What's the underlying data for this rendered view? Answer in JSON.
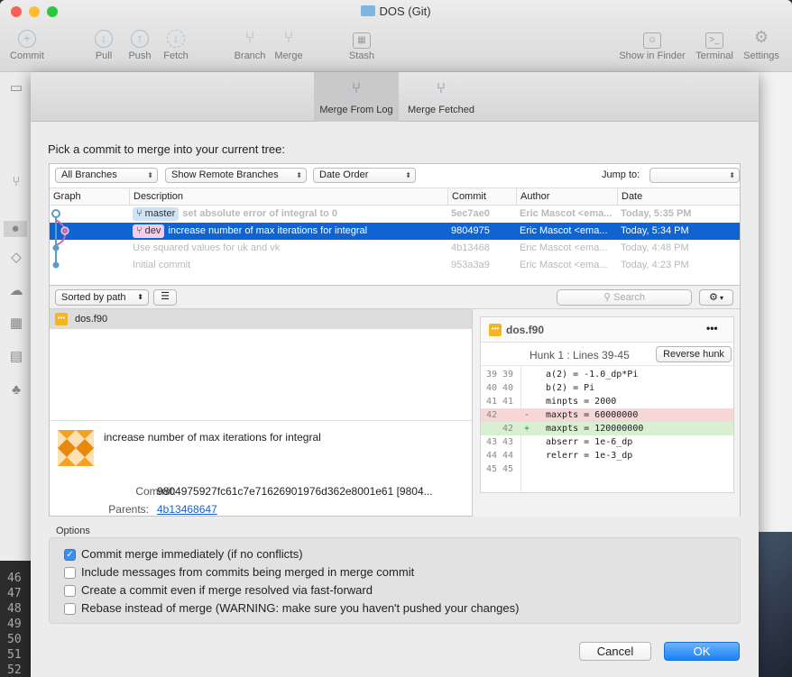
{
  "window": {
    "title": "DOS (Git)"
  },
  "toolbar": {
    "commit": "Commit",
    "pull": "Pull",
    "push": "Push",
    "fetch": "Fetch",
    "branch": "Branch",
    "merge": "Merge",
    "stash": "Stash",
    "show_in_finder": "Show in Finder",
    "terminal": "Terminal",
    "settings": "Settings"
  },
  "tabs": [
    {
      "label": "Merge From Log",
      "icon": "merge-icon",
      "selected": true
    },
    {
      "label": "Merge Fetched",
      "icon": "merge-icon",
      "selected": false
    }
  ],
  "prompt": "Pick a commit to merge into your current tree:",
  "filters": {
    "branches": "All Branches",
    "remote": "Show Remote Branches",
    "order": "Date Order",
    "jump_label": "Jump to:",
    "jump_value": ""
  },
  "columns": {
    "graph": "Graph",
    "description": "Description",
    "commit": "Commit",
    "author": "Author",
    "date": "Date"
  },
  "commits": [
    {
      "branch": "master",
      "message": "set absolute error of integral to 0",
      "hash": "5ec7ae0",
      "author": "Eric Mascot <ema...",
      "date": "Today, 5:35 PM"
    },
    {
      "branch": "dev",
      "message": "increase number of max iterations for integral",
      "hash": "9804975",
      "author": "Eric Mascot <ema...",
      "date": "Today, 5:34 PM"
    },
    {
      "branch": "",
      "message": "Use squared values for uk and vk",
      "hash": "4b13468",
      "author": "Eric Mascot <ema...",
      "date": "Today, 4:48 PM"
    },
    {
      "branch": "",
      "message": "Initial commit",
      "hash": "953a3a9",
      "author": "Eric Mascot <ema...",
      "date": "Today, 4:23 PM"
    }
  ],
  "files_toolbar": {
    "sort": "Sorted by path",
    "search_placeholder": "Search"
  },
  "selected_file": "dos.f90",
  "commit_info": {
    "message": "increase number of max iterations for integral",
    "commit_label": "Commit:",
    "commit_value": "9804975927fc61c7e71626901976d362e8001e61 [9804...",
    "parents_label": "Parents:",
    "parents_value": "4b13468647"
  },
  "diff": {
    "file": "dos.f90",
    "more": "•••",
    "hunk": "Hunk 1 : Lines 39-45",
    "reverse": "Reverse hunk",
    "lines": [
      {
        "old": "39",
        "new": "39",
        "mark": "",
        "text": "a(2) = -1.0_dp*Pi",
        "type": "ctx"
      },
      {
        "old": "40",
        "new": "40",
        "mark": "",
        "text": "b(2) = Pi",
        "type": "ctx"
      },
      {
        "old": "41",
        "new": "41",
        "mark": "",
        "text": "minpts = 2000",
        "type": "ctx"
      },
      {
        "old": "42",
        "new": "",
        "mark": "-",
        "text": "maxpts = 60000000",
        "type": "del"
      },
      {
        "old": "",
        "new": "42",
        "mark": "+",
        "text": "maxpts = 120000000",
        "type": "add"
      },
      {
        "old": "43",
        "new": "43",
        "mark": "",
        "text": "abserr = 1e-6_dp",
        "type": "ctx"
      },
      {
        "old": "44",
        "new": "44",
        "mark": "",
        "text": "relerr = 1e-3_dp",
        "type": "ctx"
      },
      {
        "old": "45",
        "new": "45",
        "mark": "",
        "text": "",
        "type": "ctx"
      }
    ]
  },
  "options": {
    "label": "Options",
    "items": [
      {
        "label": "Commit merge immediately (if no conflicts)",
        "checked": true
      },
      {
        "label": "Include messages from commits being merged in merge commit",
        "checked": false
      },
      {
        "label": "Create a commit even if merge resolved via fast-forward",
        "checked": false
      },
      {
        "label": "Rebase instead of merge (WARNING: make sure you haven't pushed your changes)",
        "checked": false
      }
    ]
  },
  "buttons": {
    "cancel": "Cancel",
    "ok": "OK"
  },
  "editor_line_numbers": [
    "46",
    "47",
    "48",
    "49",
    "50",
    "51",
    "52"
  ],
  "colors": {
    "accent": "#0f64d2",
    "del_bg": "#f6d6d6",
    "add_bg": "#d8efd2",
    "master_badge": "#cfe3f3",
    "dev_badge": "#f3cde9"
  }
}
